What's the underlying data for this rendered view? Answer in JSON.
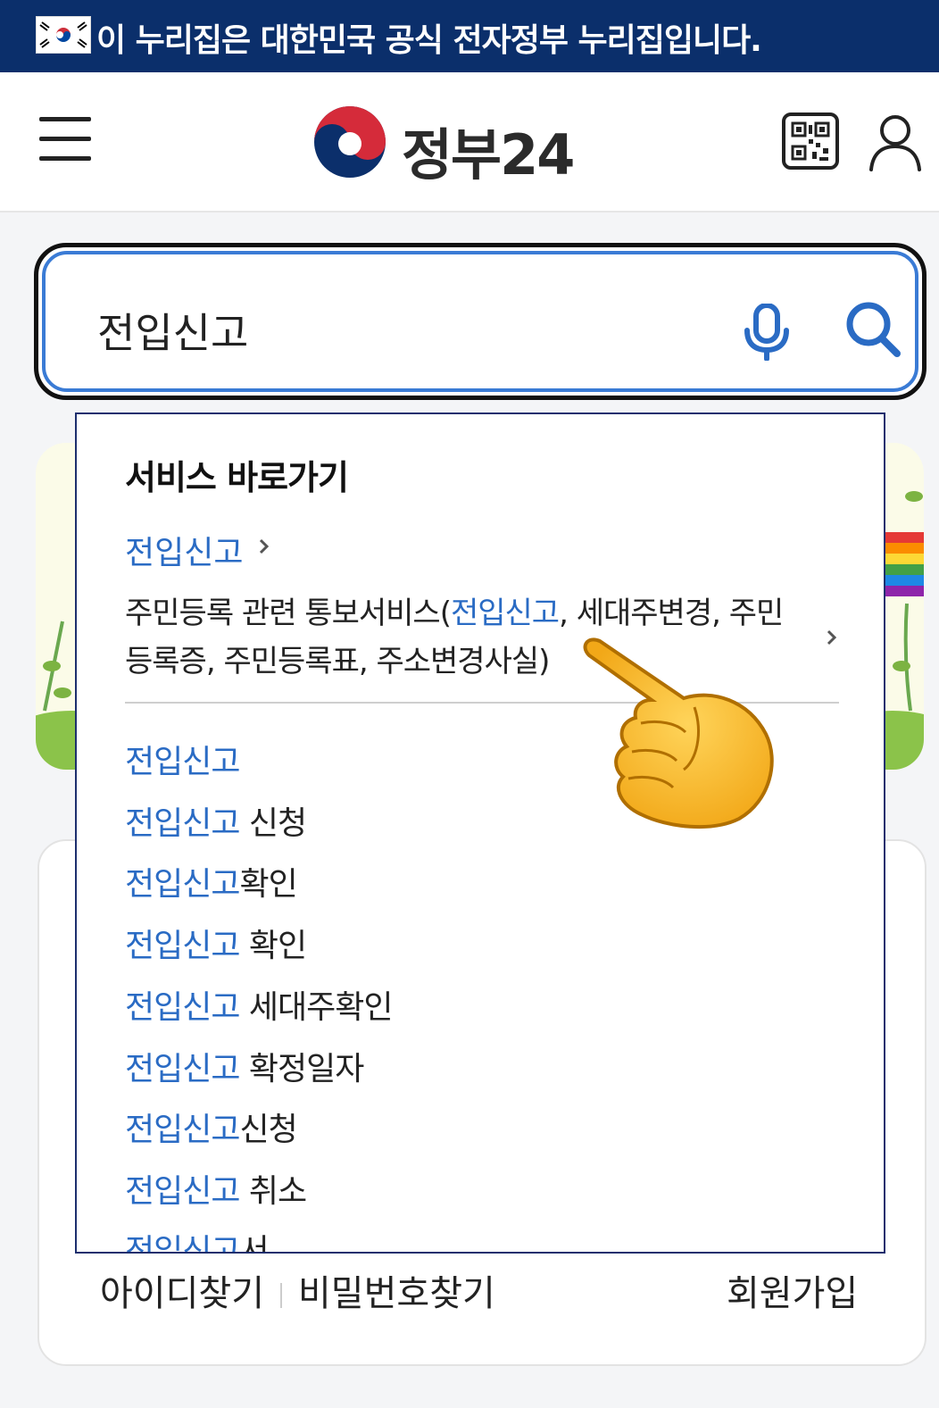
{
  "gov_banner": {
    "text": "이 누리집은 대한민국 공식 전자정부 누리집입니다."
  },
  "header": {
    "logo_text": "정부24"
  },
  "search": {
    "value": "전입신고"
  },
  "dropdown": {
    "section_title": "서비스 바로가기",
    "service_link": "전입신고",
    "service_desc": {
      "before": "주민등록 관련 통보서비스(",
      "highlight": "전입신고",
      "after": ", 세대주변경, 주민등록증, 주민등록표, 주소변경사실)"
    },
    "suggestions": [
      {
        "hl": "전입신고",
        "rest": ""
      },
      {
        "hl": "전입신고",
        "rest": " 신청"
      },
      {
        "hl": "전입신고",
        "rest": "확인"
      },
      {
        "hl": "전입신고",
        "rest": " 확인"
      },
      {
        "hl": "전입신고",
        "rest": " 세대주확인"
      },
      {
        "hl": "전입신고",
        "rest": " 확정일자"
      },
      {
        "hl": "전입신고",
        "rest": "신청"
      },
      {
        "hl": "전입신고",
        "rest": " 취소"
      },
      {
        "hl": "전입신고",
        "rest": "서"
      }
    ]
  },
  "login": {
    "find_id": "아이디찾기",
    "find_pw": "비밀번호찾기",
    "signup": "회원가입"
  },
  "colors": {
    "banner_bg": "#0b2f6b",
    "highlight": "#2a6bc4",
    "search_border": "#3a7bd5"
  },
  "icons": [
    "korea-flag-icon",
    "hamburger-menu-icon",
    "taegeuk-logo-icon",
    "qr-code-icon",
    "user-icon",
    "microphone-icon",
    "search-icon",
    "chevron-right-icon",
    "pointing-hand-icon"
  ]
}
